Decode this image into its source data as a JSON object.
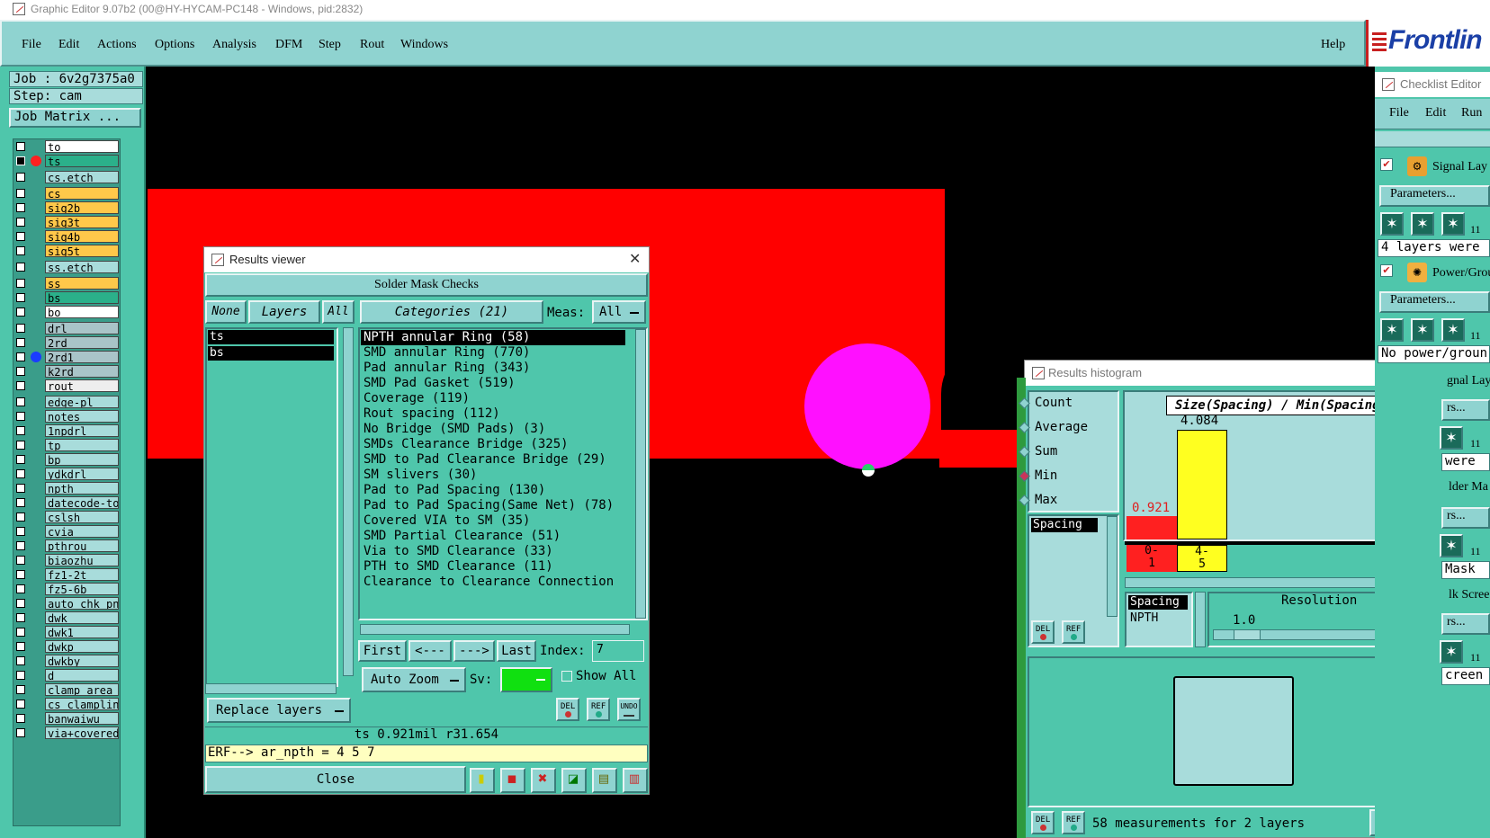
{
  "window_title": "Graphic Editor 9.07b2 (00@HY-HYCAM-PC148 - Windows, pid:2832)",
  "menu": [
    "File",
    "Edit",
    "Actions",
    "Options",
    "Analysis",
    "DFM",
    "Step",
    "Rout",
    "Windows"
  ],
  "help": "Help",
  "logo": "Frontlin",
  "job_label": "Job : 6v2g7375a0",
  "step_label": "Step: cam",
  "job_matrix": "Job Matrix ...",
  "layers": [
    {
      "name": "to",
      "color": "#ffffff",
      "dot": ""
    },
    {
      "name": "ts",
      "color": "#2bb08a",
      "dot": "#ff2020"
    },
    {
      "name": "cs.etch",
      "color": "#a8dcdb",
      "dot": ""
    },
    {
      "name": "cs",
      "color": "#ffc84a",
      "dot": ""
    },
    {
      "name": "sig2b",
      "color": "#ffc84a",
      "dot": ""
    },
    {
      "name": "sig3t",
      "color": "#ffc84a",
      "dot": ""
    },
    {
      "name": "sig4b",
      "color": "#ffc84a",
      "dot": ""
    },
    {
      "name": "sig5t",
      "color": "#ffc84a",
      "dot": ""
    },
    {
      "name": "ss.etch",
      "color": "#a8dcdb",
      "dot": ""
    },
    {
      "name": "ss",
      "color": "#ffc84a",
      "dot": ""
    },
    {
      "name": "bs",
      "color": "#2bb08a",
      "dot": ""
    },
    {
      "name": "bo",
      "color": "#ffffff",
      "dot": ""
    },
    {
      "name": "drl",
      "color": "#a9c4c8",
      "dot": ""
    },
    {
      "name": "2rd",
      "color": "#a9c4c8",
      "dot": ""
    },
    {
      "name": "2rd1",
      "color": "#a9c4c8",
      "dot": "#1a3cff"
    },
    {
      "name": "k2rd",
      "color": "#a9c4c8",
      "dot": ""
    },
    {
      "name": "rout",
      "color": "#eeeeee",
      "dot": ""
    },
    {
      "name": "edge-pl",
      "color": "#a8dcdb",
      "dot": ""
    },
    {
      "name": "notes",
      "color": "#a8dcdb",
      "dot": ""
    },
    {
      "name": "1npdrl",
      "color": "#a8dcdb",
      "dot": ""
    },
    {
      "name": "tp",
      "color": "#a8dcdb",
      "dot": ""
    },
    {
      "name": "bp",
      "color": "#a8dcdb",
      "dot": ""
    },
    {
      "name": "ydkdrl",
      "color": "#a8dcdb",
      "dot": ""
    },
    {
      "name": "npth",
      "color": "#a8dcdb",
      "dot": ""
    },
    {
      "name": "datecode-to",
      "color": "#a8dcdb",
      "dot": ""
    },
    {
      "name": "cslsh",
      "color": "#a8dcdb",
      "dot": ""
    },
    {
      "name": "cvia",
      "color": "#a8dcdb",
      "dot": ""
    },
    {
      "name": "pthrou",
      "color": "#a8dcdb",
      "dot": ""
    },
    {
      "name": "biaozhu",
      "color": "#a8dcdb",
      "dot": ""
    },
    {
      "name": "fz1-2t",
      "color": "#a8dcdb",
      "dot": ""
    },
    {
      "name": "fz5-6b",
      "color": "#a8dcdb",
      "dot": ""
    },
    {
      "name": "auto_chk_pnl",
      "color": "#a8dcdb",
      "dot": ""
    },
    {
      "name": "dwk",
      "color": "#a8dcdb",
      "dot": ""
    },
    {
      "name": "dwk1",
      "color": "#a8dcdb",
      "dot": ""
    },
    {
      "name": "dwkp",
      "color": "#a8dcdb",
      "dot": ""
    },
    {
      "name": "dwkby",
      "color": "#a8dcdb",
      "dot": ""
    },
    {
      "name": "d",
      "color": "#a8dcdb",
      "dot": ""
    },
    {
      "name": "clamp_area",
      "color": "#a8dcdb",
      "dot": ""
    },
    {
      "name": "cs_clampline",
      "color": "#a8dcdb",
      "dot": ""
    },
    {
      "name": "banwaiwu",
      "color": "#a8dcdb",
      "dot": ""
    },
    {
      "name": "via+covered",
      "color": "#a8dcdb",
      "dot": ""
    }
  ],
  "results_viewer": {
    "title": "Results viewer",
    "header": "Solder Mask Checks",
    "none_btn": "None",
    "layers_btn": "Layers",
    "all_btn": "All",
    "categories_btn": "Categories (21)",
    "meas_label": "Meas:",
    "meas_value": "All",
    "layer_list": [
      "ts",
      "bs"
    ],
    "categories": [
      "NPTH annular Ring (58)",
      "SMD annular Ring (770)",
      "Pad annular Ring (343)",
      "SMD Pad Gasket (519)",
      "Coverage (119)",
      "Rout spacing (112)",
      "No Bridge (SMD Pads) (3)",
      "SMDs Clearance Bridge (325)",
      "SMD to Pad Clearance Bridge (29)",
      "SM slivers (30)",
      "Pad to Pad Spacing (130)",
      "Pad to Pad Spacing(Same Net) (78)",
      "Covered VIA to SM (35)",
      "SMD Partial Clearance (51)",
      "Via to SMD Clearance (33)",
      "PTH to SMD Clearance (11)",
      "Clearance to Clearance Connection"
    ],
    "first": "First",
    "prev": "<---",
    "next": "--->",
    "last": "Last",
    "index_label": "Index:",
    "index_value": "7",
    "auto_zoom": "Auto Zoom",
    "sv_label": "Sv:",
    "show_all": "Show All",
    "replace_layers": "Replace layers",
    "del": "DEL",
    "ref": "REF",
    "undo": "UNDO",
    "status": "ts 0.921mil  r31.654",
    "erf": "ERF--> ar_npth = 4 5 7",
    "close": "Close"
  },
  "histogram": {
    "title": "Results histogram",
    "modes": [
      "Count",
      "Average",
      "Sum",
      "Min",
      "Max"
    ],
    "selected_mode": "Min",
    "chart_title": "Size(Spacing) / Min(Spacing)",
    "list_item": "Spacing",
    "del": "DEL",
    "ref": "REF",
    "bar1_value": "0.921",
    "bar2_value": "4.084",
    "bin1": "0-\n1",
    "bin2": "4-\n5",
    "spacing_label": "Spacing",
    "npth_label": "NPTH",
    "resolution_label": "Resolution",
    "resolution_value": "1.0",
    "status": "58 measurements for 2 layers"
  },
  "checklist": {
    "title": "Checklist Editor",
    "menu": [
      "File",
      "Edit",
      "Run"
    ],
    "item1": "Signal Lay",
    "params": "Parameters...",
    "count": "11",
    "msg1": "4 layers were",
    "item2": "Power/Grou",
    "msg2": "No power/groun",
    "item3": "gnal Lay",
    "rs": "rs...",
    "were": "were",
    "item4": "lder Ma",
    "mask": "Mask",
    "item5": "lk Scree",
    "screen": "creen"
  },
  "colors": {
    "panel": "#4fc6ab",
    "light": "#8fd3d0",
    "feature_red": "#ff0000",
    "pad_magenta": "#ff10ff",
    "bar_red": "#ff2020",
    "bar_yellow": "#ffff20"
  }
}
